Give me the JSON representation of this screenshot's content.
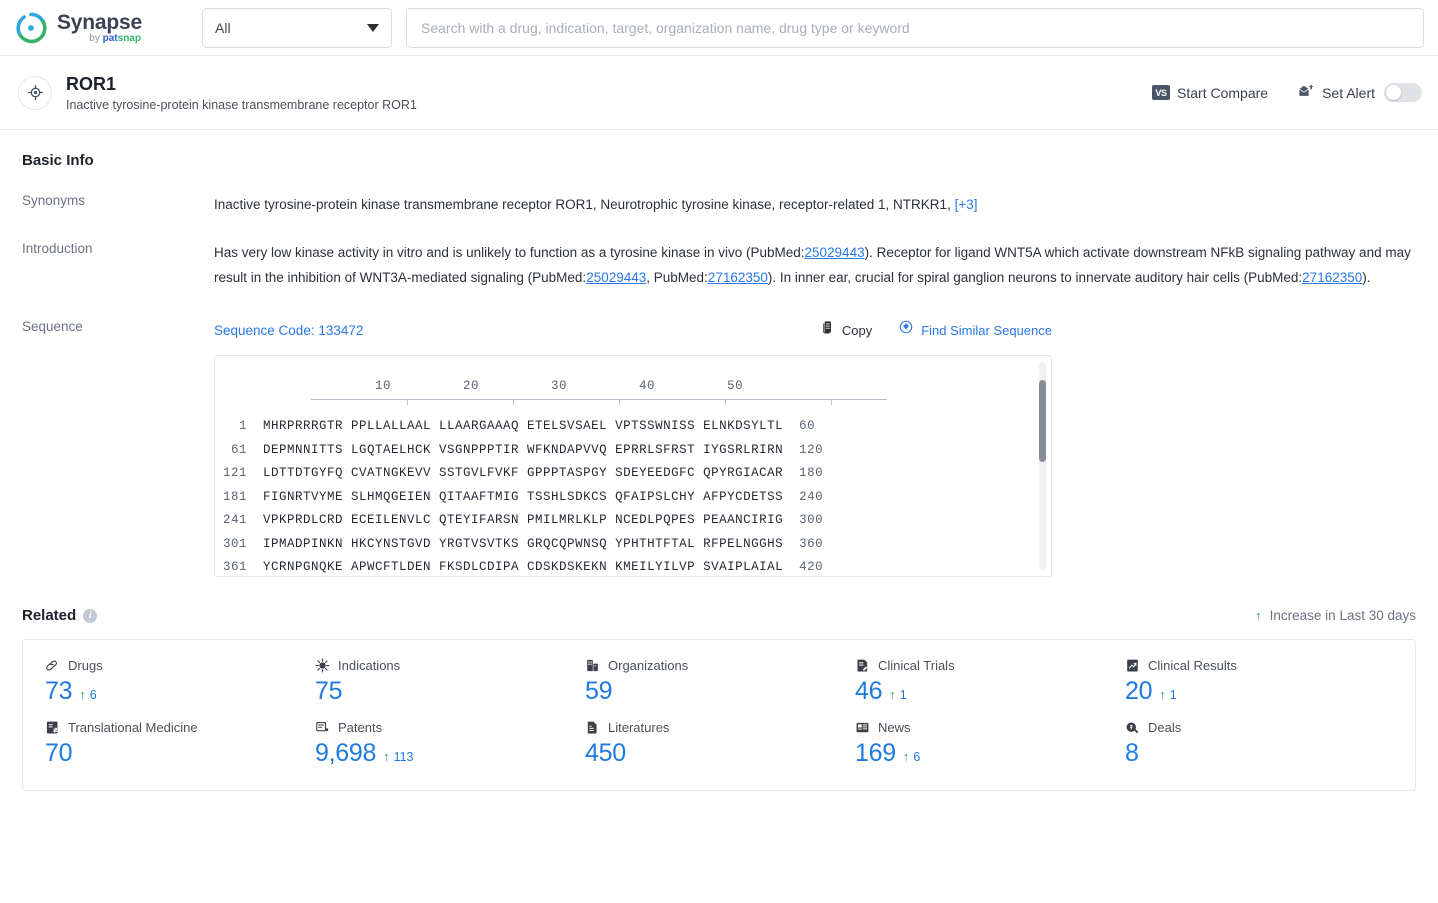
{
  "topbar": {
    "brand_name": "Synapse",
    "brand_by": "by ",
    "brand_pat": "pat",
    "brand_snap": "snap",
    "scope_value": "All",
    "search_placeholder": "Search with a drug, indication, target, organization name, drug type or keyword",
    "search_value": ""
  },
  "entity": {
    "name": "ROR1",
    "description": "Inactive tyrosine-protein kinase transmembrane receptor ROR1",
    "icon": "target-icon",
    "start_compare_label": "Start Compare",
    "start_compare_badge": "VS",
    "set_alert_label": "Set Alert",
    "alert_toggle_state": "off"
  },
  "basic_info": {
    "title": "Basic Info",
    "synonyms_label": "Synonyms",
    "synonyms_text": "Inactive tyrosine-protein kinase transmembrane receptor ROR1,  Neurotrophic tyrosine kinase, receptor-related 1,  NTRKR1,",
    "synonyms_more": "[+3]",
    "introduction_label": "Introduction",
    "introduction_parts": {
      "p1": "Has very low kinase activity in vitro and is unlikely to function as a tyrosine kinase in vivo (PubMed:",
      "l1": "25029443",
      "p2": "). Receptor for ligand WNT5A which activate downstream NFkB signaling pathway and may result in the inhibition of WNT3A-mediated signaling (PubMed:",
      "l2": "25029443",
      "p3": ", PubMed:",
      "l3": "27162350",
      "p4": "). In inner ear, crucial for spiral ganglion neurons to innervate auditory hair cells (PubMed:",
      "l4": "27162350",
      "p5": ")."
    }
  },
  "sequence": {
    "label": "Sequence",
    "code_label": "Sequence Code: 133472",
    "copy_label": "Copy",
    "find_similar_label": "Find Similar Sequence",
    "ruler_ticks": [
      "10",
      "20",
      "30",
      "40",
      "50"
    ],
    "rows": [
      {
        "start": "1",
        "blocks": "MHRPRRRGTR PPLLALLAAL LLAARGAAAQ ETELSVSAEL VPTSSWNISS ELNKDSYLTL",
        "end": "60"
      },
      {
        "start": "61",
        "blocks": "DEPMNNITTS LGQTAELHCK VSGNPPPTIR WFKNDAPVVQ EPRRLSFRST IYGSRLRIRN",
        "end": "120"
      },
      {
        "start": "121",
        "blocks": "LDTTDTGYFQ CVATNGKEVV SSTGVLFVKF GPPPTASPGY SDEYEEDGFC QPYRGIACAR",
        "end": "180"
      },
      {
        "start": "181",
        "blocks": "FIGNRTVYME SLHMQGEIEN QITAAFTMIG TSSHLSDKCS QFAIPSLCHY AFPYCDETSS",
        "end": "240"
      },
      {
        "start": "241",
        "blocks": "VPKPRDLCRD ECEILENVLC QTEYIFARSN PMILMRLKLP NCEDLPQPES PEAANCIRIG",
        "end": "300"
      },
      {
        "start": "301",
        "blocks": "IPMADPINKN HKCYNSTGVD YRGTVSVTKS GRQCQPWNSQ YPHTHTFTAL RFPELNGGHS",
        "end": "360"
      },
      {
        "start": "361",
        "blocks": "YCRNPGNQKE APWCFTLDEN FKSDLCDIPA CDSKDSKEKN KMEILYILVP SVAIPLAIAL",
        "end": "420"
      }
    ]
  },
  "related": {
    "title": "Related",
    "increase_note": "Increase in Last 30 days",
    "increase_arrow": "↑",
    "stats": [
      {
        "icon": "pill-icon",
        "label": "Drugs",
        "value": "73",
        "delta": "6"
      },
      {
        "icon": "virus-icon",
        "label": "Indications",
        "value": "75",
        "delta": ""
      },
      {
        "icon": "building-icon",
        "label": "Organizations",
        "value": "59",
        "delta": ""
      },
      {
        "icon": "trial-icon",
        "label": "Clinical Trials",
        "value": "46",
        "delta": "1"
      },
      {
        "icon": "results-icon",
        "label": "Clinical Results",
        "value": "20",
        "delta": "1"
      },
      {
        "icon": "translational-icon",
        "label": "Translational Medicine",
        "value": "70",
        "delta": ""
      },
      {
        "icon": "patent-icon",
        "label": "Patents",
        "value": "9,698",
        "delta": "113"
      },
      {
        "icon": "literature-icon",
        "label": "Literatures",
        "value": "450",
        "delta": ""
      },
      {
        "icon": "news-icon",
        "label": "News",
        "value": "169",
        "delta": "6"
      },
      {
        "icon": "deals-icon",
        "label": "Deals",
        "value": "8",
        "delta": ""
      }
    ]
  },
  "colors": {
    "accent_blue": "#1f7ae0",
    "link_blue": "#2878e8",
    "increase_green": "#2aa84f",
    "brand_green": "#35b36a",
    "border": "#e4e7eb"
  }
}
